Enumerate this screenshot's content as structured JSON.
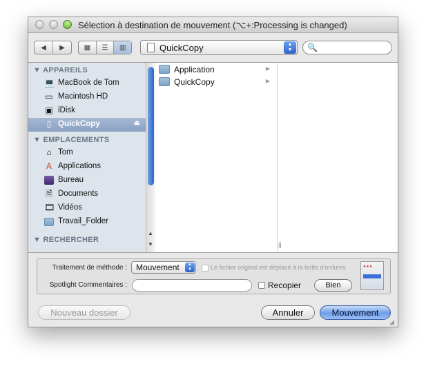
{
  "window": {
    "title": "Sélection à destination de mouvement (⌥+:Processing is changed)"
  },
  "toolbar": {
    "back_label": "◀",
    "forward_label": "▶",
    "view_icon_label": "▦",
    "view_list_label": "☰",
    "view_column_label": "▥",
    "location": "QuickCopy",
    "search_placeholder": ""
  },
  "sidebar": {
    "devices_header": "APPAREILS",
    "devices": [
      {
        "label": "MacBook de Tom",
        "icon": "laptop-icon"
      },
      {
        "label": "Macintosh HD",
        "icon": "hard-drive-icon"
      },
      {
        "label": "iDisk",
        "icon": "idisk-icon"
      },
      {
        "label": "QuickCopy",
        "icon": "volume-icon",
        "selected": true
      }
    ],
    "places_header": "EMPLACEMENTS",
    "places": [
      {
        "label": "Tom",
        "icon": "home-icon"
      },
      {
        "label": "Applications",
        "icon": "applications-icon"
      },
      {
        "label": "Bureau",
        "icon": "desktop-icon"
      },
      {
        "label": "Documents",
        "icon": "documents-icon"
      },
      {
        "label": "Vidéos",
        "icon": "movies-icon"
      },
      {
        "label": "Travail_Folder",
        "icon": "folder-icon"
      }
    ],
    "search_header": "RECHERCHER"
  },
  "columns": {
    "first": [
      {
        "label": "Application",
        "icon": "folder-alias-icon"
      },
      {
        "label": "QuickCopy",
        "icon": "folder-icon"
      }
    ]
  },
  "options": {
    "method_label": "Traitement de méthode :",
    "method_value": "Mouvement",
    "original_moved_label": "Le fichier original est déplacé à la boîte d'ordures",
    "spotlight_label": "Spotlight Commentaires :",
    "spotlight_value": "",
    "recopier_label": "Recopier",
    "bien_label": "Bien"
  },
  "buttons": {
    "new_folder": "Nouveau dossier",
    "cancel": "Annuler",
    "move": "Mouvement"
  },
  "colors": {
    "accent": "#2d63c8",
    "sidebar_bg": "#dde4ec",
    "selection": "#8ba1c3"
  }
}
